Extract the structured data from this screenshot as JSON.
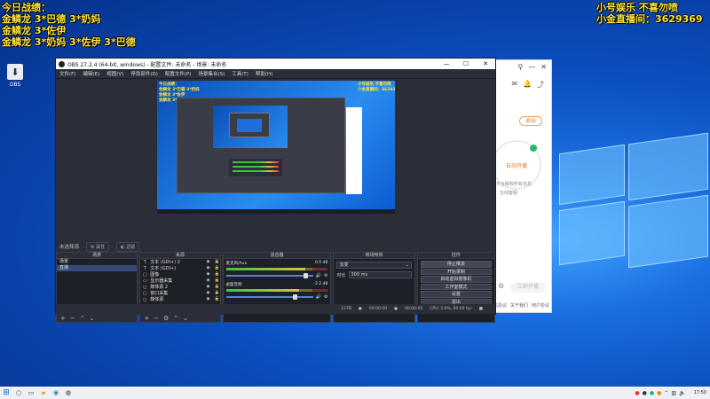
{
  "stream_overlay": {
    "left_lines": [
      "今日战绩：",
      "金鳞龙 3*巴德 3*奶妈",
      "金鳞龙 3*佐伊",
      "金鳞龙 3*奶妈 3*佐伊 3*巴德"
    ],
    "right_line1": "小号娱乐 不喜勿喷",
    "right_line2": "小金直播间：3629369"
  },
  "desktop": {
    "icon_label": "OBS"
  },
  "obs": {
    "title": "OBS 27.2.4 (64-bit, windows) - 配置文件: 未命名 - 场景: 未命名",
    "menu": [
      "文件(F)",
      "编辑(E)",
      "视图(V)",
      "停靠部件(D)",
      "配置文件(P)",
      "场景集合(S)",
      "工具(T)",
      "帮助(H)"
    ],
    "window_controls": [
      "—",
      "☐",
      "✕"
    ],
    "scene_tools_label": "未选择源",
    "props_label": "属性",
    "filters_label": "滤镜",
    "docks": {
      "scenes": {
        "title": "场景",
        "items": [
          "场景",
          "直播"
        ],
        "selected_index": 1
      },
      "sources": {
        "title": "来源",
        "items": [
          {
            "icon": "T",
            "name": "文本 (GDI+) 2"
          },
          {
            "icon": "T",
            "name": "文本 (GDI+)"
          },
          {
            "icon": "▢",
            "name": "图像"
          },
          {
            "icon": "▭",
            "name": "显示器采集"
          },
          {
            "icon": "◻",
            "name": "媒体源 2"
          },
          {
            "icon": "▢",
            "name": "窗口采集"
          },
          {
            "icon": "◻",
            "name": "媒体源"
          }
        ]
      },
      "mixer": {
        "title": "混音器",
        "channels": [
          {
            "name": "麦克风/Aux",
            "level": "0.0 dB",
            "meter_fill": 0.78,
            "volume": 0.92
          },
          {
            "name": "桌面音频",
            "level": "-2.2 dB",
            "meter_fill": 0.72,
            "volume": 0.8
          }
        ]
      },
      "transitions": {
        "title": "转场特效",
        "selected": "淡变",
        "duration_label": "时长",
        "duration_value": "300 ms"
      },
      "controls": {
        "title": "控件",
        "buttons": [
          "停止推流",
          "开始录制",
          "启动虚拟摄像机",
          "工作室模式",
          "设置",
          "退出"
        ]
      }
    },
    "status": {
      "dropped": "127B",
      "live_time": "00:00:00",
      "rec_time": "00:00:00",
      "cpu": "CPU: 5.9%, 60.00 fps"
    }
  },
  "right_app": {
    "exit_label": "退出",
    "circle_text": "自动开播",
    "hint1": "平台版权所有信息",
    "hint2": "在线客服",
    "button_label": "立即开播",
    "footer": [
      "隐私协议",
      "关于我们",
      "用户协议"
    ]
  },
  "taskbar": {
    "clock": "17:50"
  }
}
